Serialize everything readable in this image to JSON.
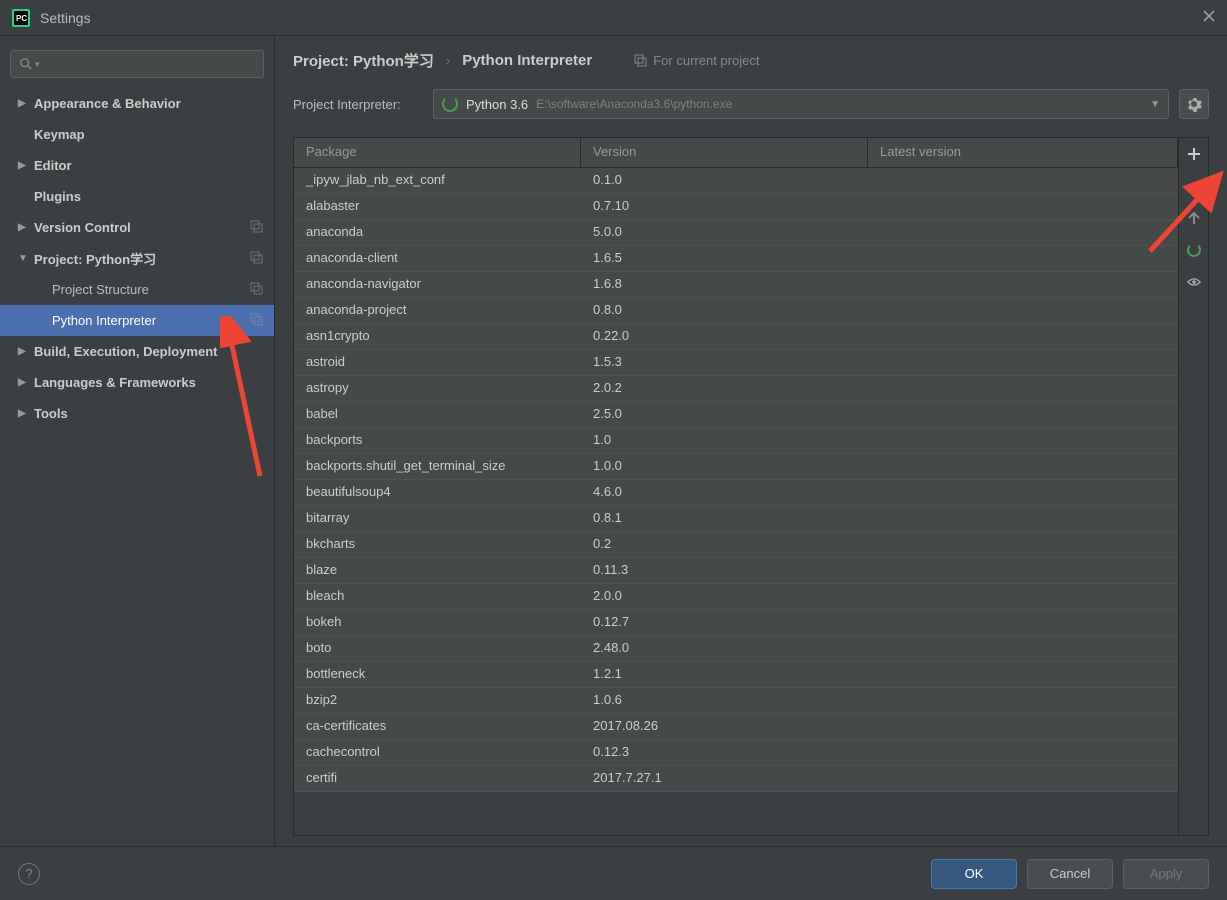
{
  "window": {
    "title": "Settings"
  },
  "sidebar": {
    "items": [
      {
        "label": "Appearance & Behavior",
        "type": "top",
        "arrow": "▶"
      },
      {
        "label": "Keymap",
        "type": "top",
        "arrow": ""
      },
      {
        "label": "Editor",
        "type": "top",
        "arrow": "▶"
      },
      {
        "label": "Plugins",
        "type": "top",
        "arrow": ""
      },
      {
        "label": "Version Control",
        "type": "top",
        "arrow": "▶",
        "copy": true
      },
      {
        "label": "Project: Python学习",
        "type": "top",
        "arrow": "▼",
        "copy": true
      },
      {
        "label": "Project Structure",
        "type": "child",
        "copy": true
      },
      {
        "label": "Python Interpreter",
        "type": "child",
        "copy": true,
        "selected": true
      },
      {
        "label": "Build, Execution, Deployment",
        "type": "top",
        "arrow": "▶"
      },
      {
        "label": "Languages & Frameworks",
        "type": "top",
        "arrow": "▶"
      },
      {
        "label": "Tools",
        "type": "top",
        "arrow": "▶"
      }
    ]
  },
  "breadcrumb": {
    "parent": "Project: Python学习",
    "child": "Python Interpreter",
    "scope": "For current project"
  },
  "interpreter": {
    "label": "Project Interpreter:",
    "name": "Python 3.6",
    "path": "E:\\software\\Anaconda3.6\\python.exe"
  },
  "table": {
    "headers": {
      "package": "Package",
      "version": "Version",
      "latest": "Latest version"
    },
    "rows": [
      {
        "pkg": "_ipyw_jlab_nb_ext_conf",
        "ver": "0.1.0"
      },
      {
        "pkg": "alabaster",
        "ver": "0.7.10"
      },
      {
        "pkg": "anaconda",
        "ver": "5.0.0"
      },
      {
        "pkg": "anaconda-client",
        "ver": "1.6.5"
      },
      {
        "pkg": "anaconda-navigator",
        "ver": "1.6.8"
      },
      {
        "pkg": "anaconda-project",
        "ver": "0.8.0"
      },
      {
        "pkg": "asn1crypto",
        "ver": "0.22.0"
      },
      {
        "pkg": "astroid",
        "ver": "1.5.3"
      },
      {
        "pkg": "astropy",
        "ver": "2.0.2"
      },
      {
        "pkg": "babel",
        "ver": "2.5.0"
      },
      {
        "pkg": "backports",
        "ver": "1.0"
      },
      {
        "pkg": "backports.shutil_get_terminal_size",
        "ver": "1.0.0"
      },
      {
        "pkg": "beautifulsoup4",
        "ver": "4.6.0"
      },
      {
        "pkg": "bitarray",
        "ver": "0.8.1"
      },
      {
        "pkg": "bkcharts",
        "ver": "0.2"
      },
      {
        "pkg": "blaze",
        "ver": "0.11.3"
      },
      {
        "pkg": "bleach",
        "ver": "2.0.0"
      },
      {
        "pkg": "bokeh",
        "ver": "0.12.7"
      },
      {
        "pkg": "boto",
        "ver": "2.48.0"
      },
      {
        "pkg": "bottleneck",
        "ver": "1.2.1"
      },
      {
        "pkg": "bzip2",
        "ver": "1.0.6"
      },
      {
        "pkg": "ca-certificates",
        "ver": "2017.08.26"
      },
      {
        "pkg": "cachecontrol",
        "ver": "0.12.3"
      },
      {
        "pkg": "certifi",
        "ver": "2017.7.27.1"
      }
    ]
  },
  "footer": {
    "ok": "OK",
    "cancel": "Cancel",
    "apply": "Apply"
  }
}
